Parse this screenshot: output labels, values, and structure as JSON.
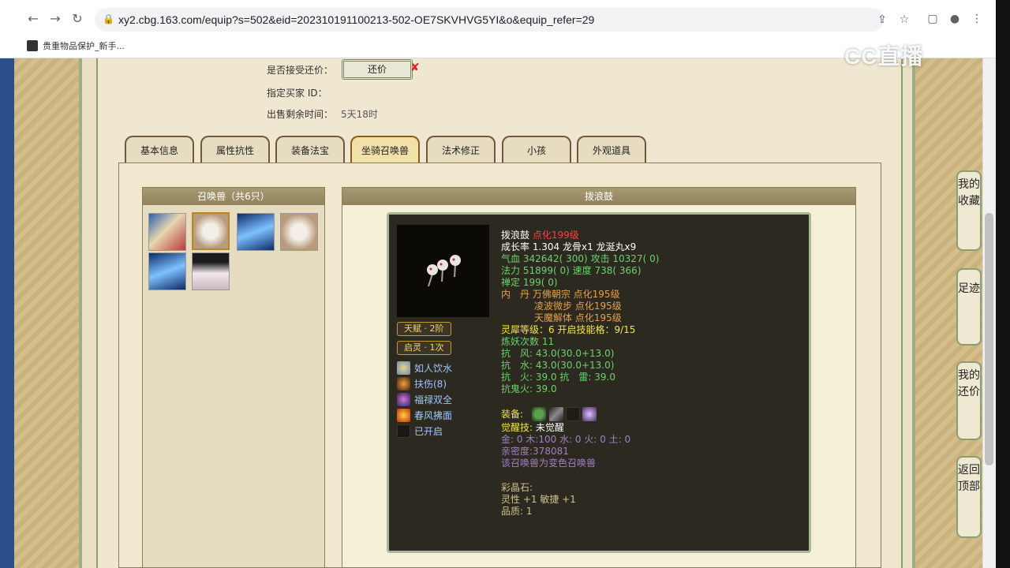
{
  "browser": {
    "url": "xy2.cbg.163.com/equip?s=502&eid=202310191100213-502-OE7SKVHVG5YI&o&equip_refer=29",
    "bookmark": "贵重物品保护_新手..."
  },
  "watermark": "CC直播",
  "info": {
    "accept_counter_label": "是否接受还价：",
    "counter_button": "还价",
    "buyer_id_label": "指定买家 ID：",
    "remaining_label": "出售剩余时间：",
    "remaining_value": "5天18时"
  },
  "tabs": [
    "基本信息",
    "属性抗性",
    "装备法宝",
    "坐骑召唤兽",
    "法术修正",
    "小孩",
    "外观道具"
  ],
  "summon_panel": {
    "title": "召唤兽（共6只）"
  },
  "detail": {
    "header": "拨浪鼓",
    "name": "拨浪鼓",
    "rank": "点化199级",
    "growth": "成长率 1.304 龙骨x1 龙涎丸x9",
    "hp_label": "气血",
    "hp": "342642( 300)",
    "atk_label": "攻击",
    "atk": "10327( 0)",
    "mp_label": "法力",
    "mp": "51899( 0)",
    "spd_label": "速度",
    "spd": "738( 366)",
    "zen_label": "禅定",
    "zen": "199( 0)",
    "dan_label": "内　丹",
    "dan1": "万佛朝宗 点化195级",
    "dan2": "凌波微步 点化195级",
    "dan3": "天魔解体 点化195级",
    "soul_line": "灵犀等级：6 开启技能格：9/15",
    "refine": "炼妖次数 11",
    "res1": "抗　风: 43.0(30.0+13.0)",
    "res2": "抗　水: 43.0(30.0+13.0)",
    "res3": "抗　火: 39.0 抗　雷: 39.0",
    "res4": "抗鬼火: 39.0",
    "equip_label": "装备:",
    "awaken_label": "觉醒技:",
    "awaken_value": "未觉醒",
    "elements": "金: 0 木:100 水: 0 火: 0 土: 0",
    "intimacy": "亲密度:378081",
    "variant": "该召唤兽为变色召唤兽",
    "crystal_label": "彩晶石:",
    "crystal_value": "灵性 +1 敏捷 +1",
    "quality": "品质: 1"
  },
  "tags": [
    "天赋 · 2阶",
    "启灵 · 1次"
  ],
  "skills": [
    "如人饮水",
    "扶伤(8)",
    "福禄双全",
    "春风拂面",
    "已开启"
  ],
  "sidebar": [
    "我的收藏",
    "足迹",
    "我的还价",
    "返回顶部"
  ],
  "colors": {
    "accent_gold": "#c39a2f",
    "panel_dark": "#2c2a20",
    "header_khaki": "#8f825d"
  }
}
